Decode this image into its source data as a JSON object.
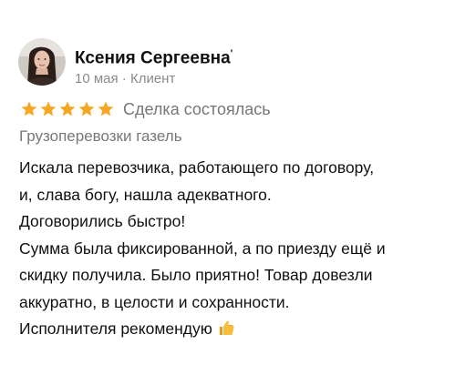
{
  "review": {
    "author_name": "Ксения Сергеевна",
    "author_mark": "'",
    "meta": "10 мая · Клиент",
    "rating": 5,
    "rating_max": 5,
    "star_color": "#f5a623",
    "deal_status": "Сделка состоялась",
    "service": "Грузоперевозки газель",
    "text_lines": [
      "Искала перевозчика, работающего по договору,",
      "и, слава богу, нашла адекватного.",
      "Договорились быстро!",
      "Сумма была фиксированной, а по приезду ещё и",
      "скидку получила. Было приятно! Товар довезли",
      "аккуратно, в целости и сохранности.",
      "Исполнителя рекомендую"
    ],
    "end_icon": "thumbs-up-icon"
  }
}
